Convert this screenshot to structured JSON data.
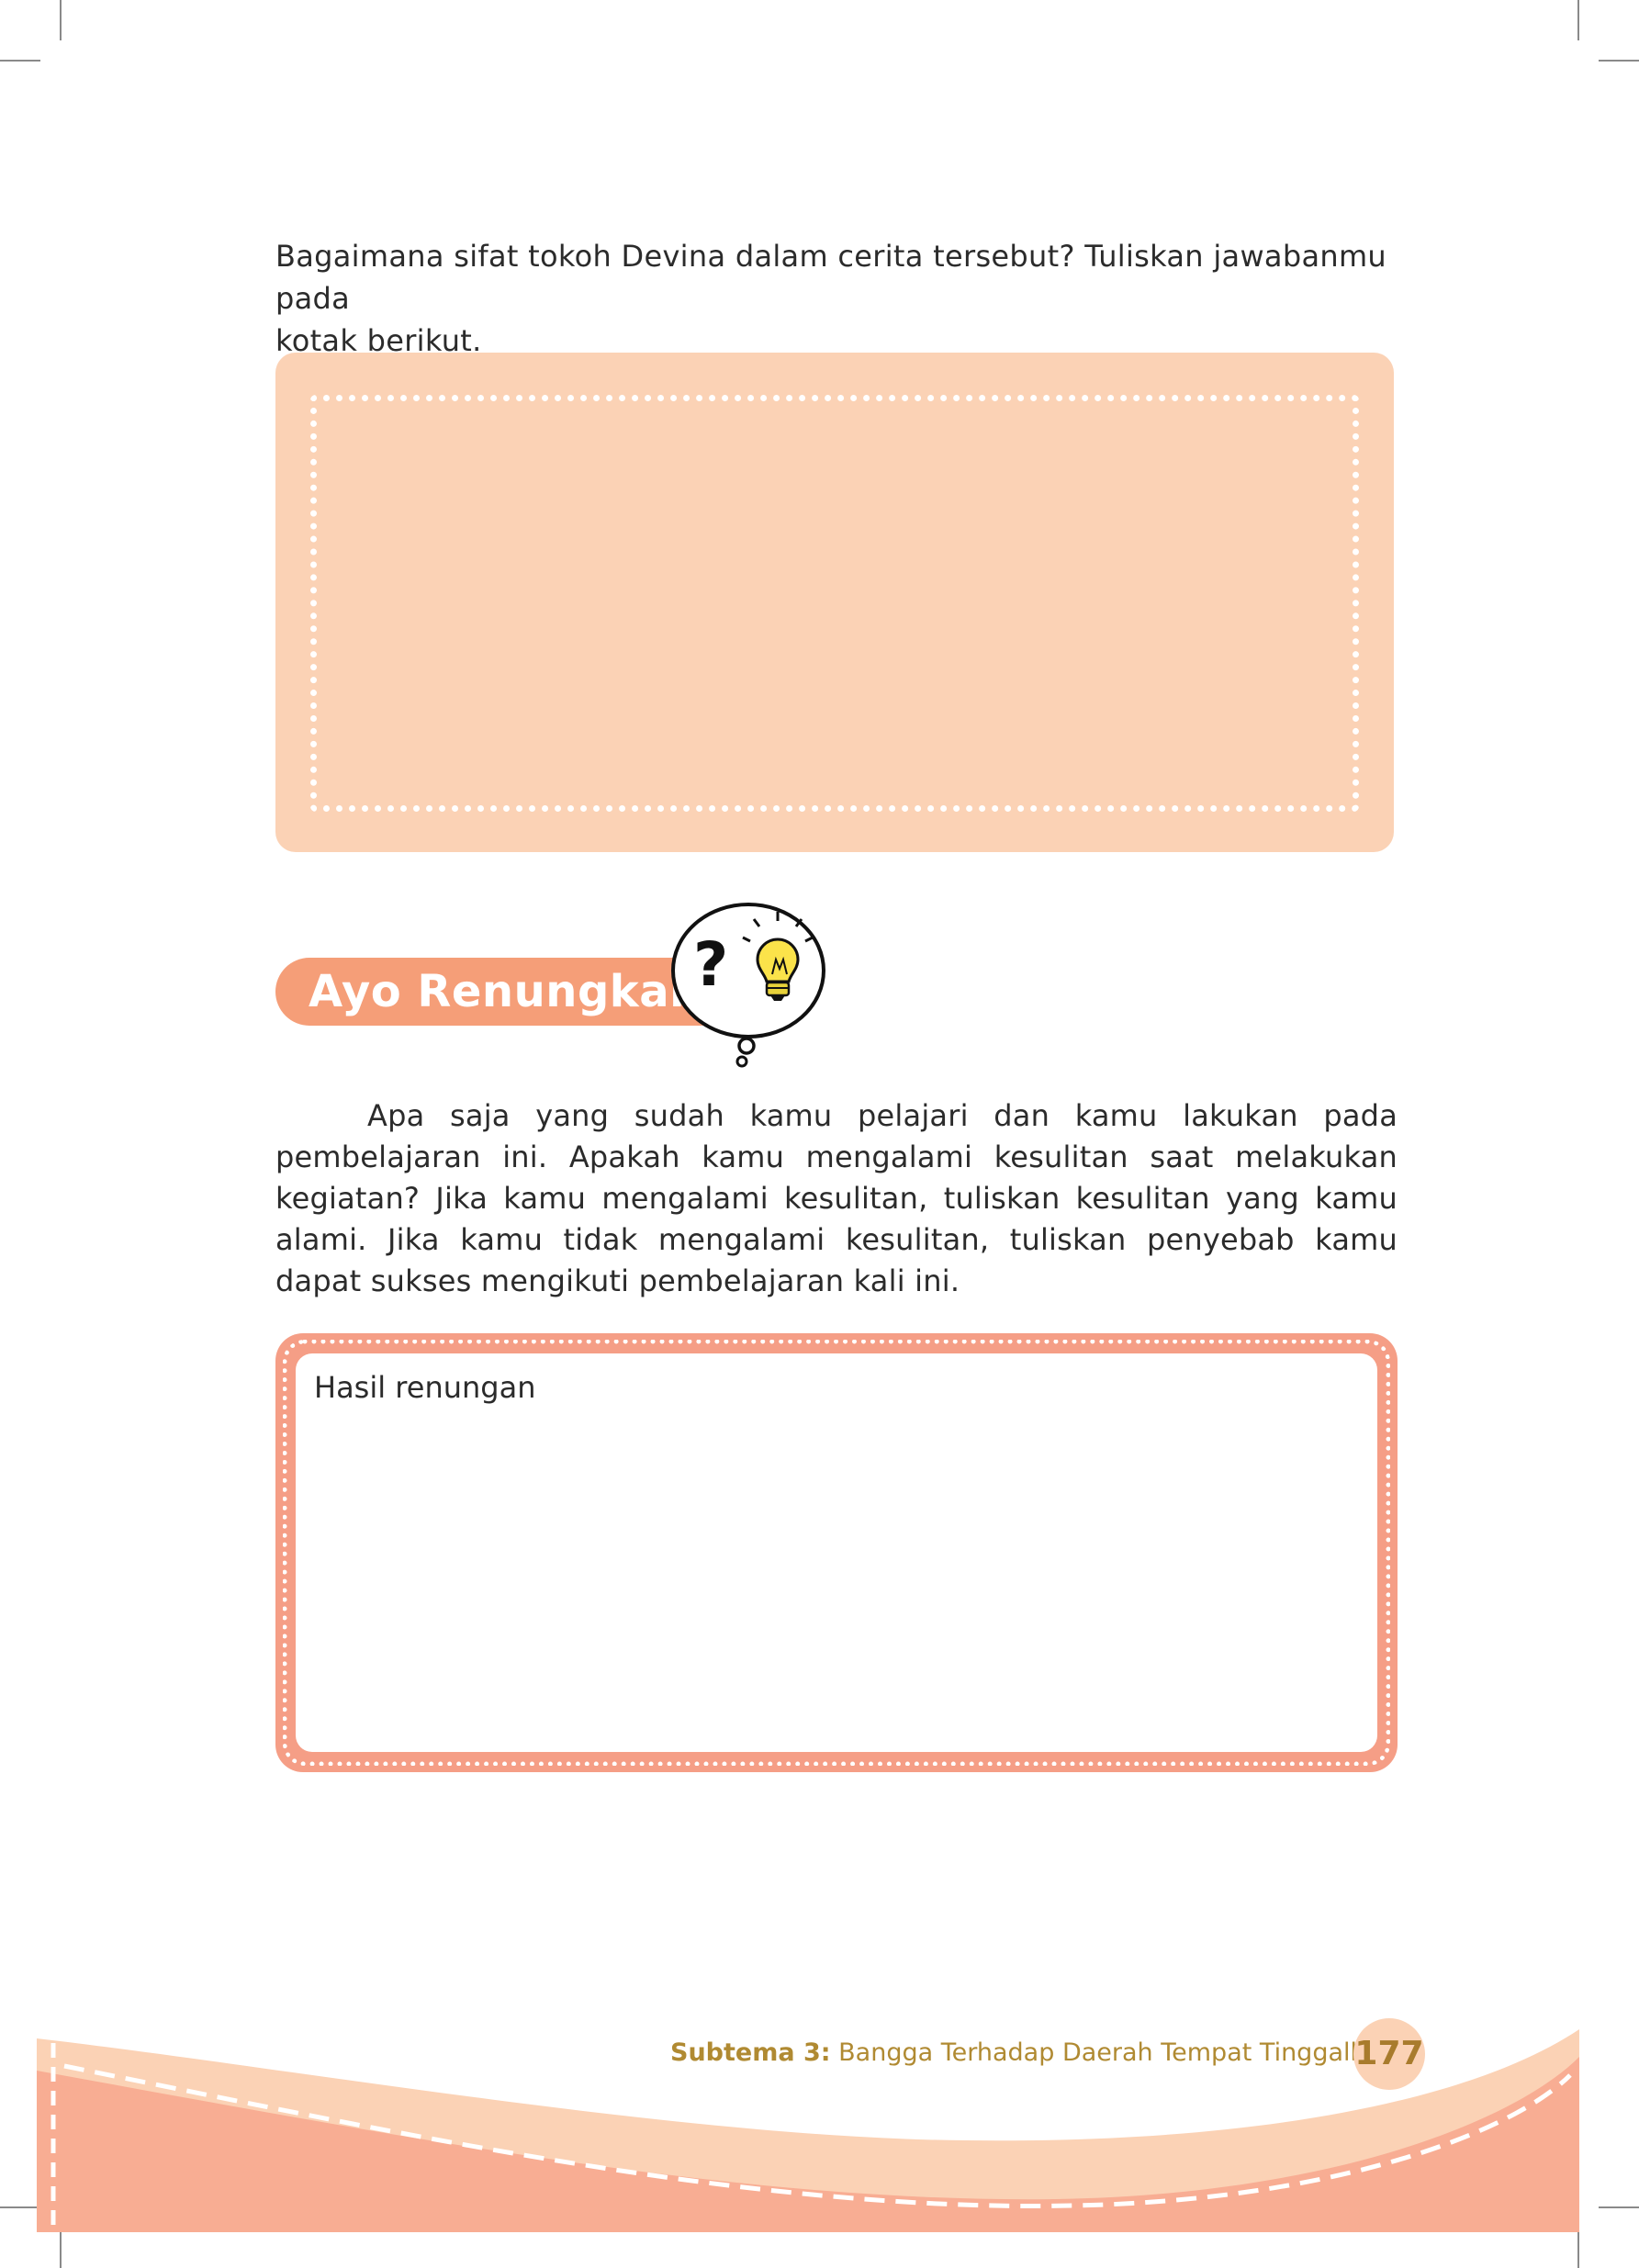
{
  "question": {
    "line1": "Bagaimana sifat tokoh Devina dalam cerita tersebut? Tuliskan jawabanmu pada",
    "line2": "kotak berikut."
  },
  "section": {
    "title": "Ayo Renungkan"
  },
  "reflection": {
    "paragraph": "Apa saja yang sudah kamu pelajari dan kamu lakukan pada pembelajaran ini. Apakah kamu mengalami kesulitan saat melakukan kegiatan? Jika kamu mengalami kesulitan, tuliskan kesulitan yang kamu alami. Jika kamu tidak mengalami kesulitan, tuliskan penyebab kamu dapat sukses mengikuti pembelajaran kali ini."
  },
  "result_box": {
    "label": "Hasil renungan"
  },
  "footer": {
    "subtheme_label": "Subtema 3:",
    "subtheme_title": "Bangga Terhadap Daerah Tempat Tinggalku",
    "page_number": "177"
  },
  "icons": {
    "thought_bubble": "thought-bubble-icon",
    "question_mark": "question-mark-icon",
    "light_bulb": "light-bulb-icon"
  },
  "colors": {
    "answer_box": "#fbd2b5",
    "banner": "#f59e78",
    "result_frame": "#f59e86",
    "footer_dark": "#f8ad93",
    "footer_light": "#fbd2b5",
    "footer_text": "#b08a32"
  }
}
